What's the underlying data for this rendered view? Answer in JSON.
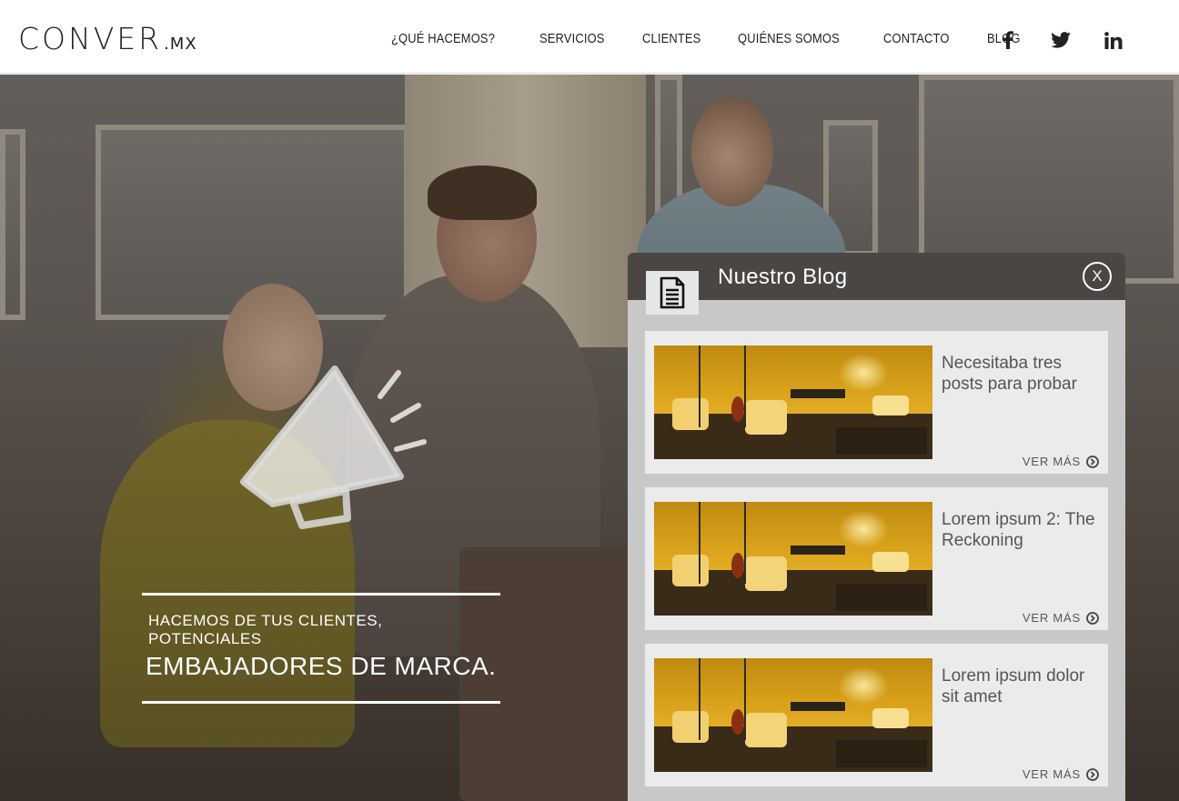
{
  "brand": {
    "name": "CONVER",
    "tld": ".MX"
  },
  "nav": {
    "items": [
      {
        "label": "¿QUÉ HACEMOS?"
      },
      {
        "label": "SERVICIOS"
      },
      {
        "label": "CLIENTES"
      },
      {
        "label": "QUIÉNES SOMOS"
      },
      {
        "label": "CONTACTO"
      },
      {
        "label": "BLOG"
      }
    ]
  },
  "social": {
    "icons": [
      "facebook-icon",
      "twitter-icon",
      "linkedin-icon"
    ]
  },
  "hero": {
    "tagline_small": "HACEMOS DE TUS CLIENTES, POTENCIALES",
    "tagline_big": "EMBAJADORES DE MARCA."
  },
  "blog": {
    "title": "Nuestro Blog",
    "close_label": "X",
    "more_label": "VER MÁS",
    "posts": [
      {
        "title": "Necesitaba tres posts para probar"
      },
      {
        "title": "Lorem ipsum 2: The Reckoning"
      },
      {
        "title": "Lorem ipsum dolor sit amet"
      }
    ]
  },
  "colors": {
    "blog_header": "#4a4644",
    "blog_panel": "#c8c8c8",
    "post_card": "#ebebeb",
    "text_dark": "#222222"
  }
}
